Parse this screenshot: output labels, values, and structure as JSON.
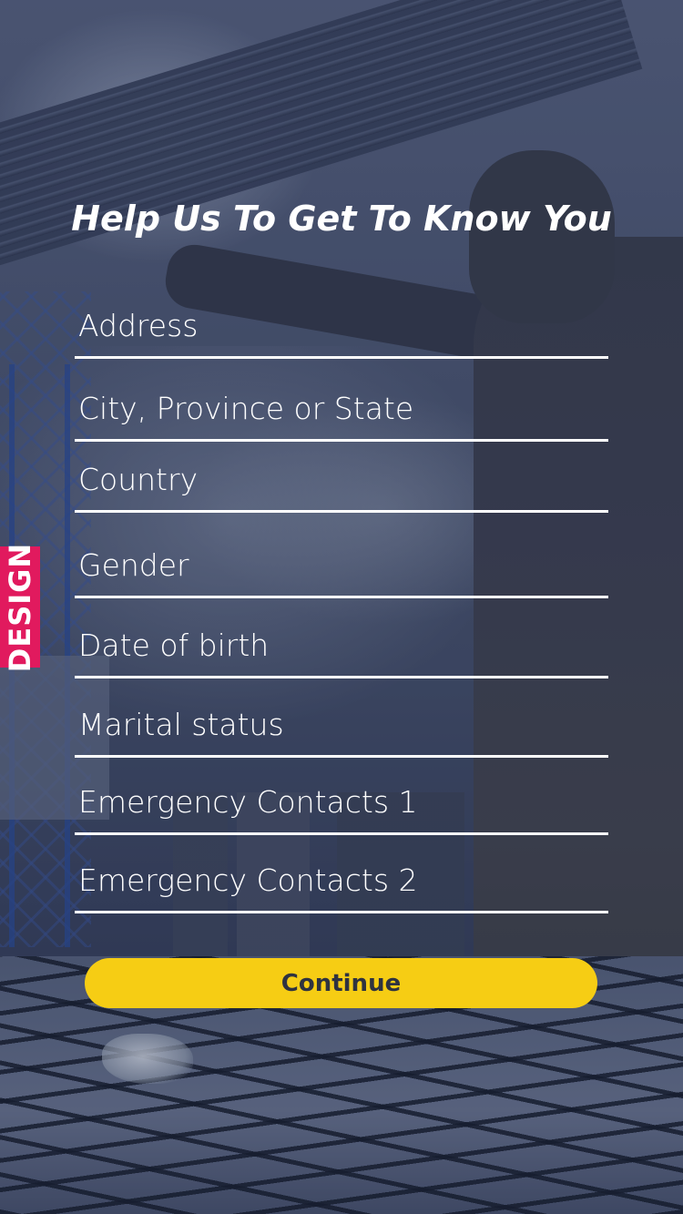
{
  "page": {
    "title": "Help Us To Get To Know You",
    "side_badge": "DESIGN"
  },
  "form": {
    "fields": [
      {
        "name": "address",
        "placeholder": "Address",
        "value": ""
      },
      {
        "name": "city",
        "placeholder": "City, Province or State",
        "value": ""
      },
      {
        "name": "country",
        "placeholder": "Country",
        "value": ""
      },
      {
        "name": "gender",
        "placeholder": "Gender",
        "value": ""
      },
      {
        "name": "date-of-birth",
        "placeholder": "Date of birth",
        "value": ""
      },
      {
        "name": "marital-status",
        "placeholder": "Marital status",
        "value": ""
      },
      {
        "name": "emergency-contact-1",
        "placeholder": "Emergency Contacts 1",
        "value": ""
      },
      {
        "name": "emergency-contact-2",
        "placeholder": "Emergency Contacts 2",
        "value": ""
      }
    ],
    "continue_label": "Continue"
  },
  "colors": {
    "button": "#f6cd14",
    "button_text": "#2f3340",
    "badge": "#e11a5e",
    "text": "#ffffff"
  }
}
